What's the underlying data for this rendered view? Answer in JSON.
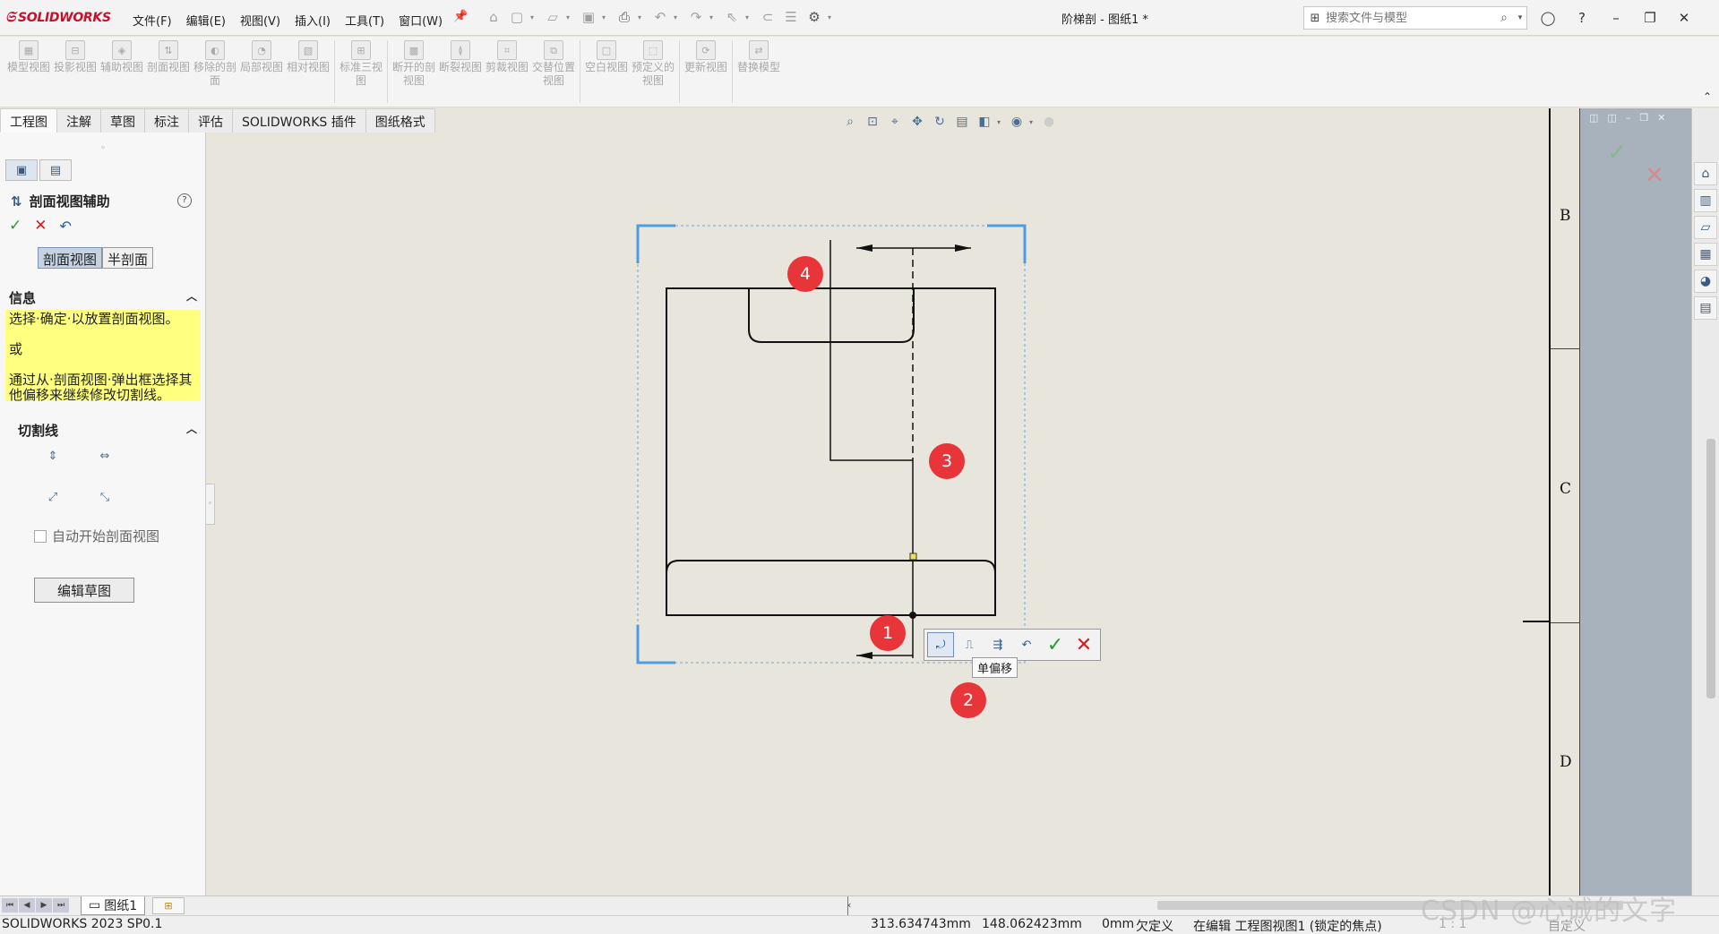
{
  "app": {
    "brand": "SOLIDWORKS",
    "document_title": "阶梯剖 - 图纸1 *",
    "menus": [
      "文件(F)",
      "编辑(E)",
      "视图(V)",
      "插入(I)",
      "工具(T)",
      "窗口(W)"
    ],
    "search": {
      "placeholder": "搜索文件与模型"
    }
  },
  "ribbon": {
    "tools": [
      "模型视图",
      "投影视图",
      "辅助视图",
      "剖面视图",
      "移除的剖面",
      "局部视图",
      "相对视图",
      "标准三视图",
      "断开的剖视图",
      "断裂视图",
      "剪裁视图",
      "交替位置视图",
      "空白视图",
      "预定义的视图",
      "更新视图",
      "替换模型"
    ]
  },
  "tabs": [
    "工程图",
    "注解",
    "草图",
    "标注",
    "评估",
    "SOLIDWORKS 插件",
    "图纸格式"
  ],
  "property_manager": {
    "title": "剖面视图辅助",
    "segments": [
      "剖面视图",
      "半剖面"
    ],
    "info_header": "信息",
    "info_lines": [
      "选择·确定·以放置剖面视图。",
      "或",
      "通过从·剖面视图·弹出框选择其他偏移来继续修改切割线。"
    ],
    "cutline_header": "切割线",
    "auto_start_label": "自动开始剖面视图",
    "edit_sketch_label": "编辑草图"
  },
  "sheet": {
    "zones": [
      "B",
      "C",
      "D"
    ]
  },
  "popup_toolbar": {
    "tooltip": "单偏移"
  },
  "badges": [
    "1",
    "2",
    "3",
    "4"
  ],
  "sheet_tab": "图纸1",
  "status": {
    "version": "SOLIDWORKS 2023 SP0.1",
    "x": "313.634743mm",
    "y": "148.062423mm",
    "z": "0mm",
    "definition": "欠定义",
    "editing": "在编辑 工程图视图1 (锁定的焦点)",
    "scale": "1 : 1",
    "custom": "自定义"
  },
  "watermark": "CSDN @心诚的文字",
  "colors": {
    "accent_blue": "#4f9de0",
    "badge_red": "#e8353a",
    "info_yellow": "#ffff80",
    "canvas": "#e8e6dc"
  }
}
